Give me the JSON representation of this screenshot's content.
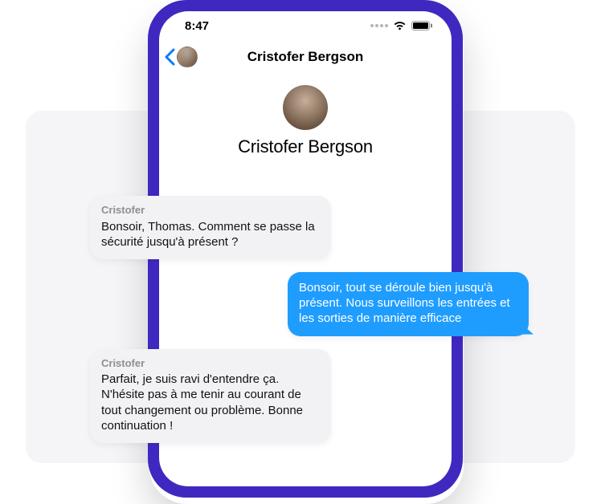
{
  "status": {
    "time": "8:47"
  },
  "header": {
    "title": "Cristofer Bergson"
  },
  "profile": {
    "name": "Cristofer Bergson"
  },
  "colors": {
    "phone_frame": "#3f28c0",
    "outgoing_bubble": "#1f9dff",
    "incoming_bubble": "#f2f2f4",
    "ios_blue": "#007aff"
  },
  "messages": [
    {
      "sender": "Cristofer",
      "direction": "incoming",
      "text": "Bonsoir, Thomas. Comment se passe la sécurité jusqu'à présent ?"
    },
    {
      "sender": "me",
      "direction": "outgoing",
      "text": "Bonsoir, tout se déroule bien jusqu'à présent. Nous surveillons les entrées et les sorties de manière efficace"
    },
    {
      "sender": "Cristofer",
      "direction": "incoming",
      "text": "Parfait, je suis ravi d'entendre ça. N'hésite pas à me tenir au courant de tout changement ou problème. Bonne continuation !"
    }
  ]
}
